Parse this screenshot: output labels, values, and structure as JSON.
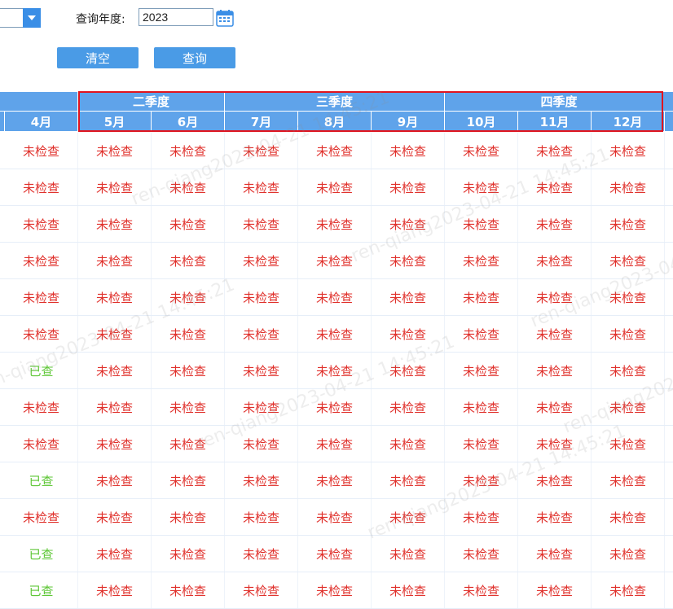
{
  "filter": {
    "year_label": "查询年度:",
    "year_value": "2023",
    "clear_label": "清空",
    "query_label": "查询"
  },
  "quarters": [
    {
      "label": "二季度"
    },
    {
      "label": "三季度"
    },
    {
      "label": "四季度"
    }
  ],
  "months": [
    "4月",
    "5月",
    "6月",
    "7月",
    "8月",
    "9月",
    "10月",
    "11月",
    "12月"
  ],
  "status_text": {
    "no": "未检查",
    "yes": "已查"
  },
  "rows": [
    [
      "no",
      "no",
      "no",
      "no",
      "no",
      "no",
      "no",
      "no",
      "no"
    ],
    [
      "no",
      "no",
      "no",
      "no",
      "no",
      "no",
      "no",
      "no",
      "no"
    ],
    [
      "no",
      "no",
      "no",
      "no",
      "no",
      "no",
      "no",
      "no",
      "no"
    ],
    [
      "no",
      "no",
      "no",
      "no",
      "no",
      "no",
      "no",
      "no",
      "no"
    ],
    [
      "no",
      "no",
      "no",
      "no",
      "no",
      "no",
      "no",
      "no",
      "no"
    ],
    [
      "no",
      "no",
      "no",
      "no",
      "no",
      "no",
      "no",
      "no",
      "no"
    ],
    [
      "yes",
      "no",
      "no",
      "no",
      "no",
      "no",
      "no",
      "no",
      "no"
    ],
    [
      "no",
      "no",
      "no",
      "no",
      "no",
      "no",
      "no",
      "no",
      "no"
    ],
    [
      "no",
      "no",
      "no",
      "no",
      "no",
      "no",
      "no",
      "no",
      "no"
    ],
    [
      "yes",
      "no",
      "no",
      "no",
      "no",
      "no",
      "no",
      "no",
      "no"
    ],
    [
      "no",
      "no",
      "no",
      "no",
      "no",
      "no",
      "no",
      "no",
      "no"
    ],
    [
      "yes",
      "no",
      "no",
      "no",
      "no",
      "no",
      "no",
      "no",
      "no"
    ],
    [
      "yes",
      "no",
      "no",
      "no",
      "no",
      "no",
      "no",
      "no",
      "no"
    ]
  ],
  "colors": {
    "header": "#5fa3ea",
    "not_checked": "#e0312c",
    "checked": "#5cc634",
    "highlight": "#e0141e"
  },
  "watermark": "ren-qiang2023-04-21 14:45:21"
}
